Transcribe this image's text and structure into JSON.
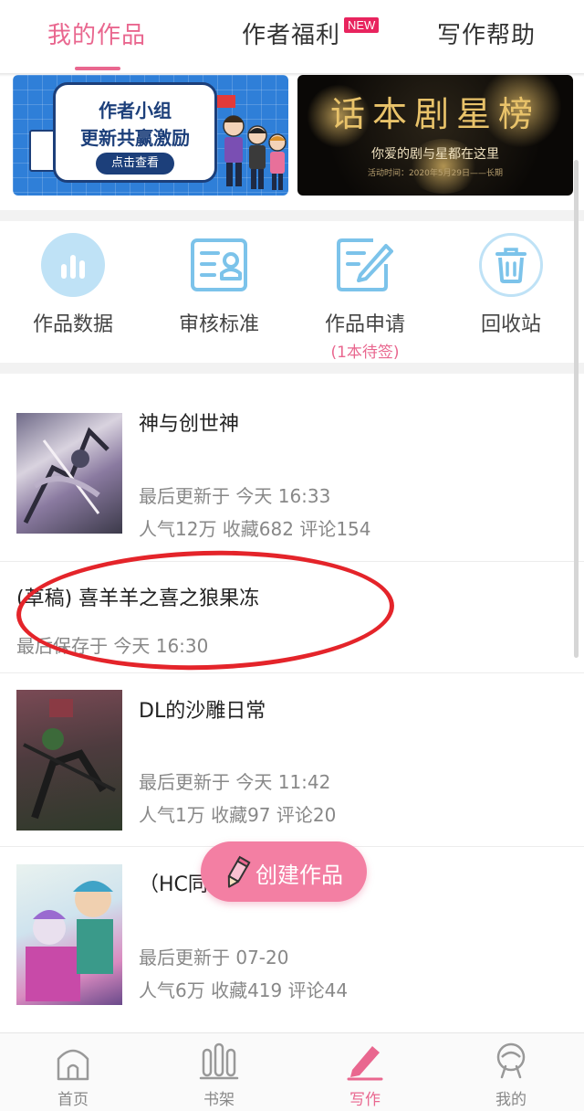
{
  "top_tabs": {
    "my_works": "我的作品",
    "author_welfare": "作者福利",
    "new_badge": "NEW",
    "writing_help": "写作帮助"
  },
  "banners": {
    "left": {
      "line1": "作者小组",
      "line2": "更新共赢激励",
      "button": "点击查看"
    },
    "right": {
      "title": "话本剧星榜",
      "subtitle": "你爱的剧与星都在这里",
      "date": "活动时间：2020年5月29日——长期"
    }
  },
  "tools": [
    {
      "label": "作品数据",
      "sub": "",
      "icon": "bar-chart-icon"
    },
    {
      "label": "审核标准",
      "sub": "",
      "icon": "stamp-document-icon"
    },
    {
      "label": "作品申请",
      "sub": "(1本待签)",
      "icon": "edit-document-icon"
    },
    {
      "label": "回收站",
      "sub": "",
      "icon": "trash-icon"
    }
  ],
  "works": [
    {
      "title": "神与创世神",
      "updated": "最后更新于 今天 16:33",
      "stats": "人气12万 收藏682 评论154"
    },
    {
      "title": "(草稿) 喜羊羊之喜之狼果冻",
      "updated": "最后保存于 今天 16:30",
      "stats": ""
    },
    {
      "title": "DL的沙雕日常",
      "updated": "最后更新于 今天 11:42",
      "stats": "人气1万 收藏97 评论20"
    },
    {
      "title": "（HC同",
      "updated": "最后更新于 07-20",
      "stats": "人气6万 收藏419 评论44"
    }
  ],
  "fab": {
    "label": "创建作品"
  },
  "bottom_nav": {
    "home": "首页",
    "shelf": "书架",
    "write": "写作",
    "me": "我的"
  },
  "colors": {
    "accent": "#e9678f",
    "annotation": "#e4242a",
    "fab": "#f37fa3",
    "icon_blue": "#7cc3ea"
  }
}
